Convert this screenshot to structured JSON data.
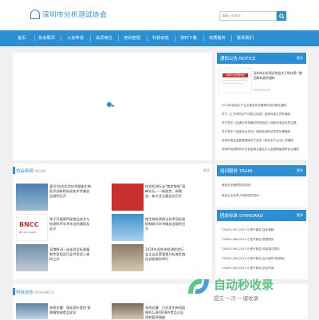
{
  "header": {
    "logo_text": "深圳市分析测试协会",
    "search_placeholder": "请输入关键字"
  },
  "nav": {
    "items": [
      "首页",
      "协会概况",
      "入会申请",
      "会员单位",
      "培训管理",
      "科技动态",
      "资料下载",
      "资质服务",
      "联系我们"
    ]
  },
  "notice": {
    "title": "通知公告",
    "title_en": "NOTICE",
    "more": "更多",
    "featured_title": "深圳市分析测试协会关于举办第二期团体标准的通知",
    "featured_date": "2020-03-19",
    "featured_img_text": "深圳市分析测试协会",
    "items": [
      "2024年食品生产企业食品安全管理员培训报名通知",
      "关于《工作场所空气中粉尘测定》团体标准立项的通知",
      "关于发布《血清中有机磷农药的测定》团体标准征求意见稿",
      "关于发布《连续流分析仪》团体标准的征求意见稿通知",
      "深圳市食品监督管理局关于发布《食品生产企业》的通知",
      "深圳市检测机构行业协会第五届会员大会暨换届选举会议通知"
    ]
  },
  "association_news": {
    "title": "协会新闻",
    "title_en": "NEWS",
    "more": "更多",
    "items": [
      {
        "text": "喜讯!协会实验技术赋能生物医学创新的标准化学术服务会顺利召开"
      },
      {
        "text": "检验检测行业“散本增效”高峰论坛——新趋势、新挑战、新方法主题会议召开"
      },
      {
        "text": "关于开展第四届食品安全与检测技术学术年会的通知及征文"
      },
      {
        "text": "微生物检测前沿技术及标准研制研讨学术服务会顺利召开"
      },
      {
        "text": "深港联动—送走会员标准编制专家组及行业专家深入调研工作"
      },
      {
        "text": "2024年深圳市检测检验行业企业运营管理与标准实施培训班顺利举行"
      }
    ],
    "logo_text": "BNCC",
    "logo_subtext": "Bio Sci Center"
  },
  "train": {
    "title": "培训服务",
    "title_en": "TRAIN",
    "more": "更多",
    "items": [
      "食品安全管理员培训班",
      "食品企业负责人和检验员培训"
    ]
  },
  "standard": {
    "title": "团体标准",
    "title_en": "STANDARD",
    "more": "更多",
    "items": [
      "T/SATA 067-2023 小型气象站 技术规程",
      "T/SATA 066-2023 小型气象站 数据规范",
      "T/SATA 065-2023 小型气象站 安装调试规范",
      "T/SATA 064-2023 小型气象站 运行维护(测试版)",
      "T/SATA 063-2023 小型气象站 站址环境"
    ]
  },
  "dynamics": {
    "title": "科技动态",
    "title_en": "DYNAMICS",
    "items": [
      {
        "text": "海关总署：强化源头管控 保障植物源食品安全"
      },
      {
        "text": "海关总署：已对发生新冠疫情的1280家海外食品企业采取暂停措施"
      }
    ]
  },
  "watermark": {
    "brand": "自动秒收录",
    "slogan": "提交·一次·一键收录"
  }
}
